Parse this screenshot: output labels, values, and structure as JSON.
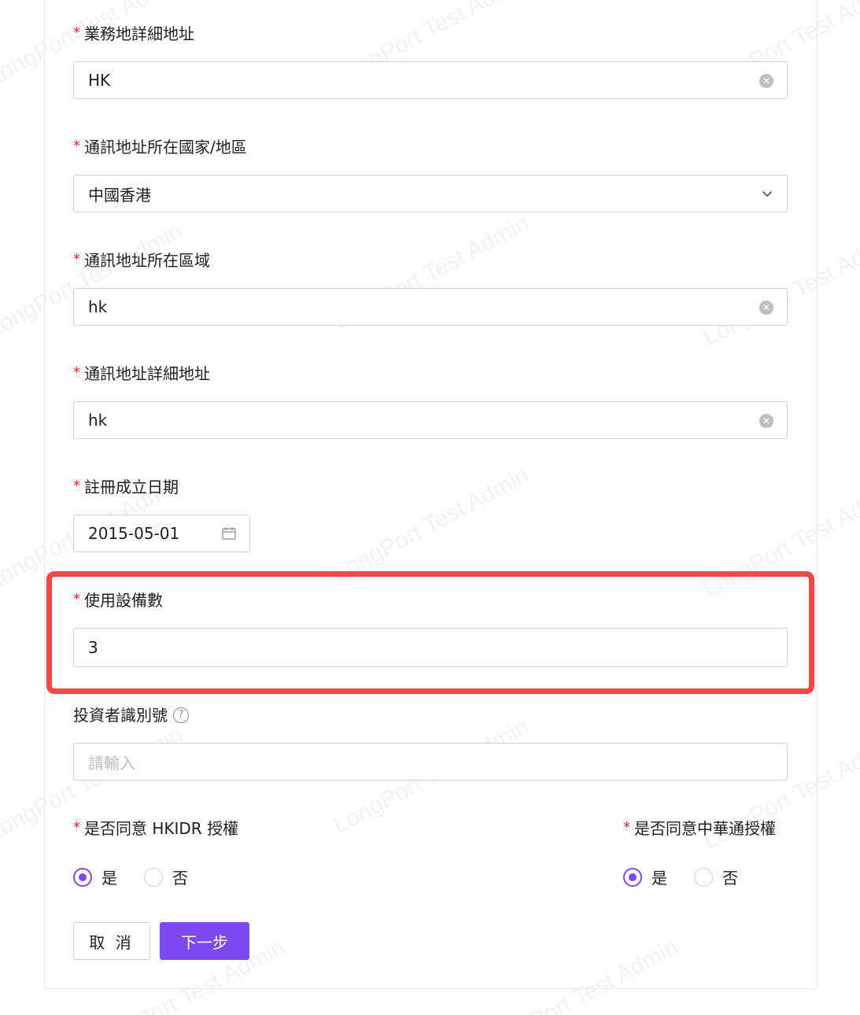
{
  "watermark_text": "LongPort Test Admin",
  "fields": {
    "business_address": {
      "label": "業務地詳細地址",
      "value": "HK"
    },
    "mail_country": {
      "label": "通訊地址所在國家/地區",
      "value": "中國香港"
    },
    "mail_region": {
      "label": "通訊地址所在區域",
      "value": "hk"
    },
    "mail_address": {
      "label": "通訊地址詳細地址",
      "value": "hk"
    },
    "reg_date": {
      "label": "註冊成立日期",
      "value": "2015-05-01"
    },
    "device_count": {
      "label": "使用設備數",
      "value": "3"
    },
    "investor_id": {
      "label": "投資者識別號",
      "placeholder": "請輸入"
    }
  },
  "consent_hkidr": {
    "label": "是否同意 HKIDR 授權",
    "yes": "是",
    "no": "否",
    "selected": "yes"
  },
  "consent_china": {
    "label": "是否同意中華通授權",
    "yes": "是",
    "no": "否",
    "selected": "yes"
  },
  "buttons": {
    "cancel": "取 消",
    "next": "下一步"
  },
  "colors": {
    "accent": "#7b4af0",
    "required": "#f5222d",
    "highlight": "#f44848"
  }
}
